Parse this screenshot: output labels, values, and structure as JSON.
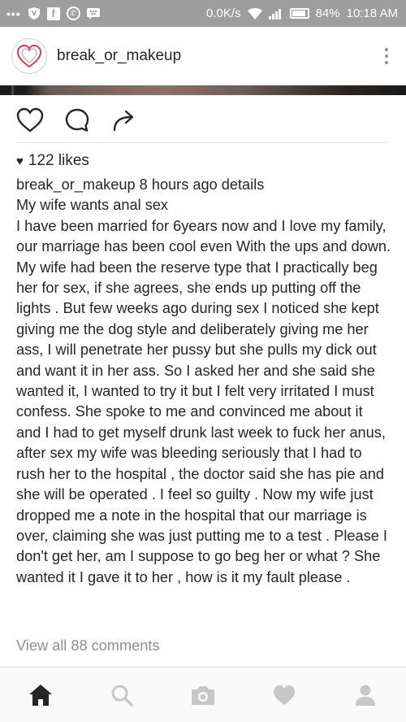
{
  "status_bar": {
    "network_speed": "0.0K/s",
    "battery_percent": "84%",
    "time": "10:18 AM",
    "left_icons": [
      "more-dots-icon",
      "shield-icon",
      "facebook-icon",
      "whatsapp-icon",
      "bbm-icon"
    ],
    "right_icons": [
      "wifi-icon",
      "signal-icon",
      "battery-icon"
    ]
  },
  "post": {
    "username": "break_or_makeup",
    "avatar_icon": "heart-avatar-icon",
    "likes": "122 likes",
    "caption": {
      "author": "break_or_makeup",
      "meta": " 8 hours ago details",
      "title": "My wife wants anal sex",
      "body": "I have been married for 6years now and I love my family, our marriage has been cool even With the ups and down. My wife had been the reserve type that I practically beg her for sex, if she agrees, she ends up putting off the lights . But few weeks ago during sex I noticed she kept giving me the dog style and deliberately giving me her ass, I will penetrate her pussy but she pulls my dick out and want it in her ass. So I asked her and she said she wanted it, I wanted to try it but I felt very irritated I must confess. She spoke to me and convinced me about it and I had to get myself drunk last week to fuck her anus, after sex my wife was bleeding seriously that I had to rush her to the hospital , the doctor said she has pie and she will be operated . I feel so guilty . Now my wife just dropped me a note in the hospital that our marriage is over, claiming she was just putting me to a test . Please I don't get her, am I suppose to go beg her or what ? She wanted it I gave it to her , how is it my fault please ."
    },
    "view_comments": "View all 88 comments"
  },
  "colors": {
    "status_bar_bg": "#9e9e9e",
    "text": "#262626",
    "muted": "#8e8e8e",
    "avatar_accent": "#e0394a"
  },
  "bottom_nav": [
    {
      "icon": "home-icon",
      "active": true
    },
    {
      "icon": "search-icon",
      "active": false
    },
    {
      "icon": "camera-icon",
      "active": false
    },
    {
      "icon": "heart-icon",
      "active": false
    },
    {
      "icon": "profile-icon",
      "active": false
    }
  ]
}
